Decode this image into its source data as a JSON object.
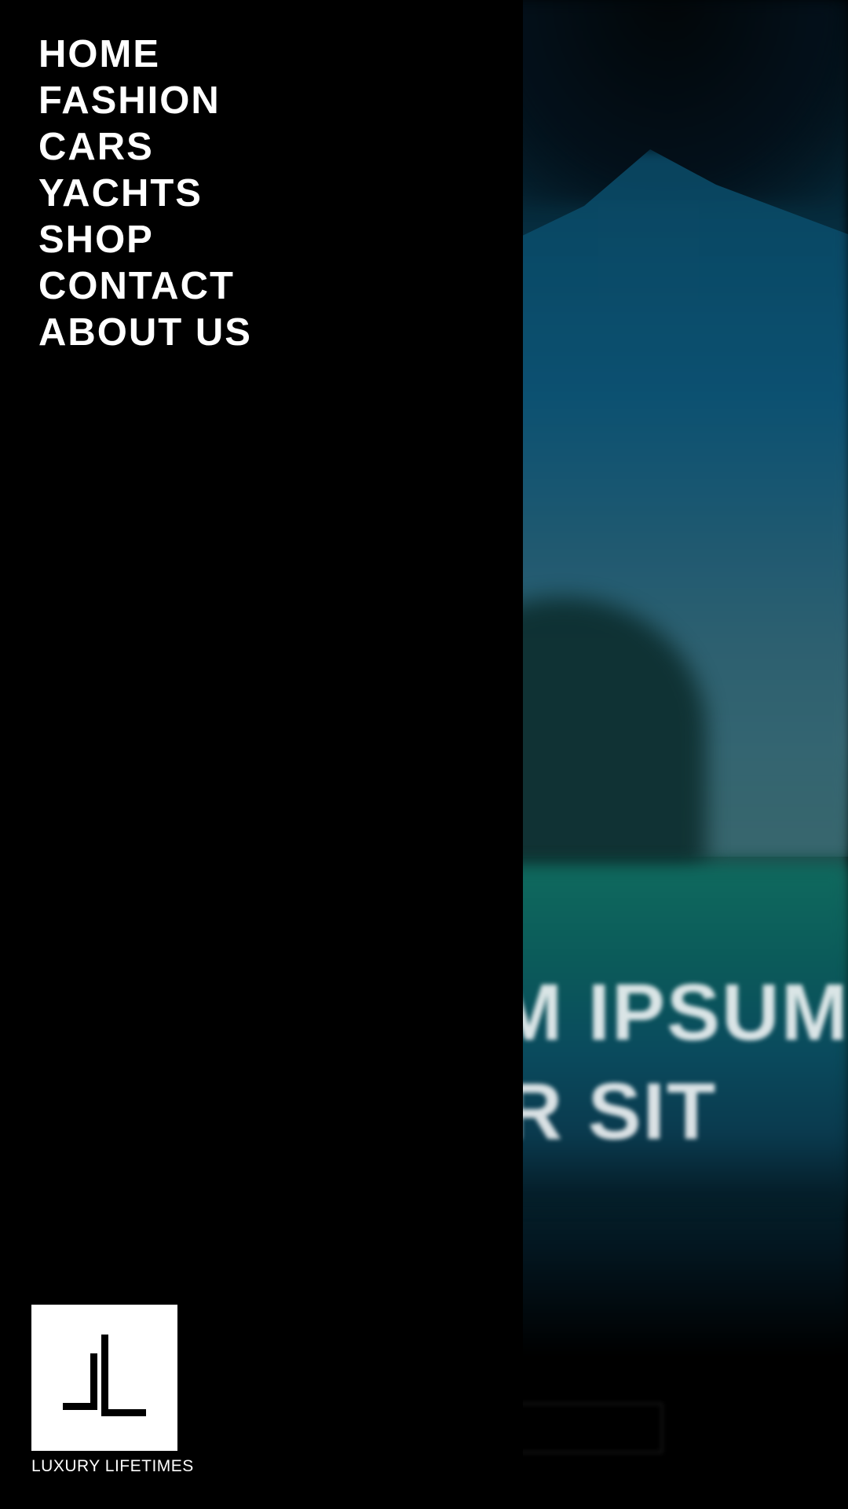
{
  "nav": {
    "items": [
      {
        "label": "HOME"
      },
      {
        "label": "FASHION"
      },
      {
        "label": "CARS"
      },
      {
        "label": "YACHTS"
      },
      {
        "label": "SHOP"
      },
      {
        "label": "CONTACT"
      },
      {
        "label": "ABOUT US"
      }
    ]
  },
  "brand": {
    "name": "LUXURY LIFETIMES",
    "logo_icon": "ll-monogram-icon"
  },
  "hero": {
    "title_line1": "LOREM IPSUM",
    "title_line2": "DOLOR SIT",
    "text": "",
    "overlay": "blurred"
  },
  "colors": {
    "drawer_bg": "#000000",
    "nav_text": "#ffffff",
    "logo_bg": "#ffffff",
    "logo_mark": "#000000"
  }
}
